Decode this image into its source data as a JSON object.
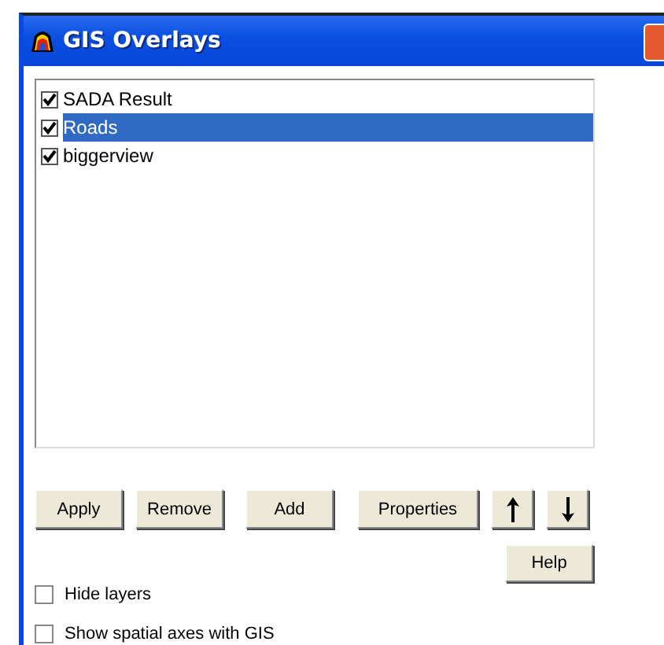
{
  "window": {
    "title": "GIS Overlays"
  },
  "layers": [
    {
      "label": "SADA Result",
      "checked": true,
      "selected": false
    },
    {
      "label": "Roads",
      "checked": true,
      "selected": true
    },
    {
      "label": "biggerview",
      "checked": true,
      "selected": false
    }
  ],
  "buttons": [
    {
      "kind": "text",
      "label": "Apply"
    },
    {
      "kind": "text",
      "label": "Remove"
    },
    {
      "kind": "text",
      "label": "Add"
    },
    {
      "kind": "text",
      "label": "Properties"
    },
    {
      "kind": "up"
    },
    {
      "kind": "down"
    }
  ],
  "help_button": {
    "label": "Help"
  },
  "options": [
    {
      "label": "Hide layers",
      "checked": false
    },
    {
      "label": "Show spatial axes with GIS",
      "checked": false
    }
  ]
}
